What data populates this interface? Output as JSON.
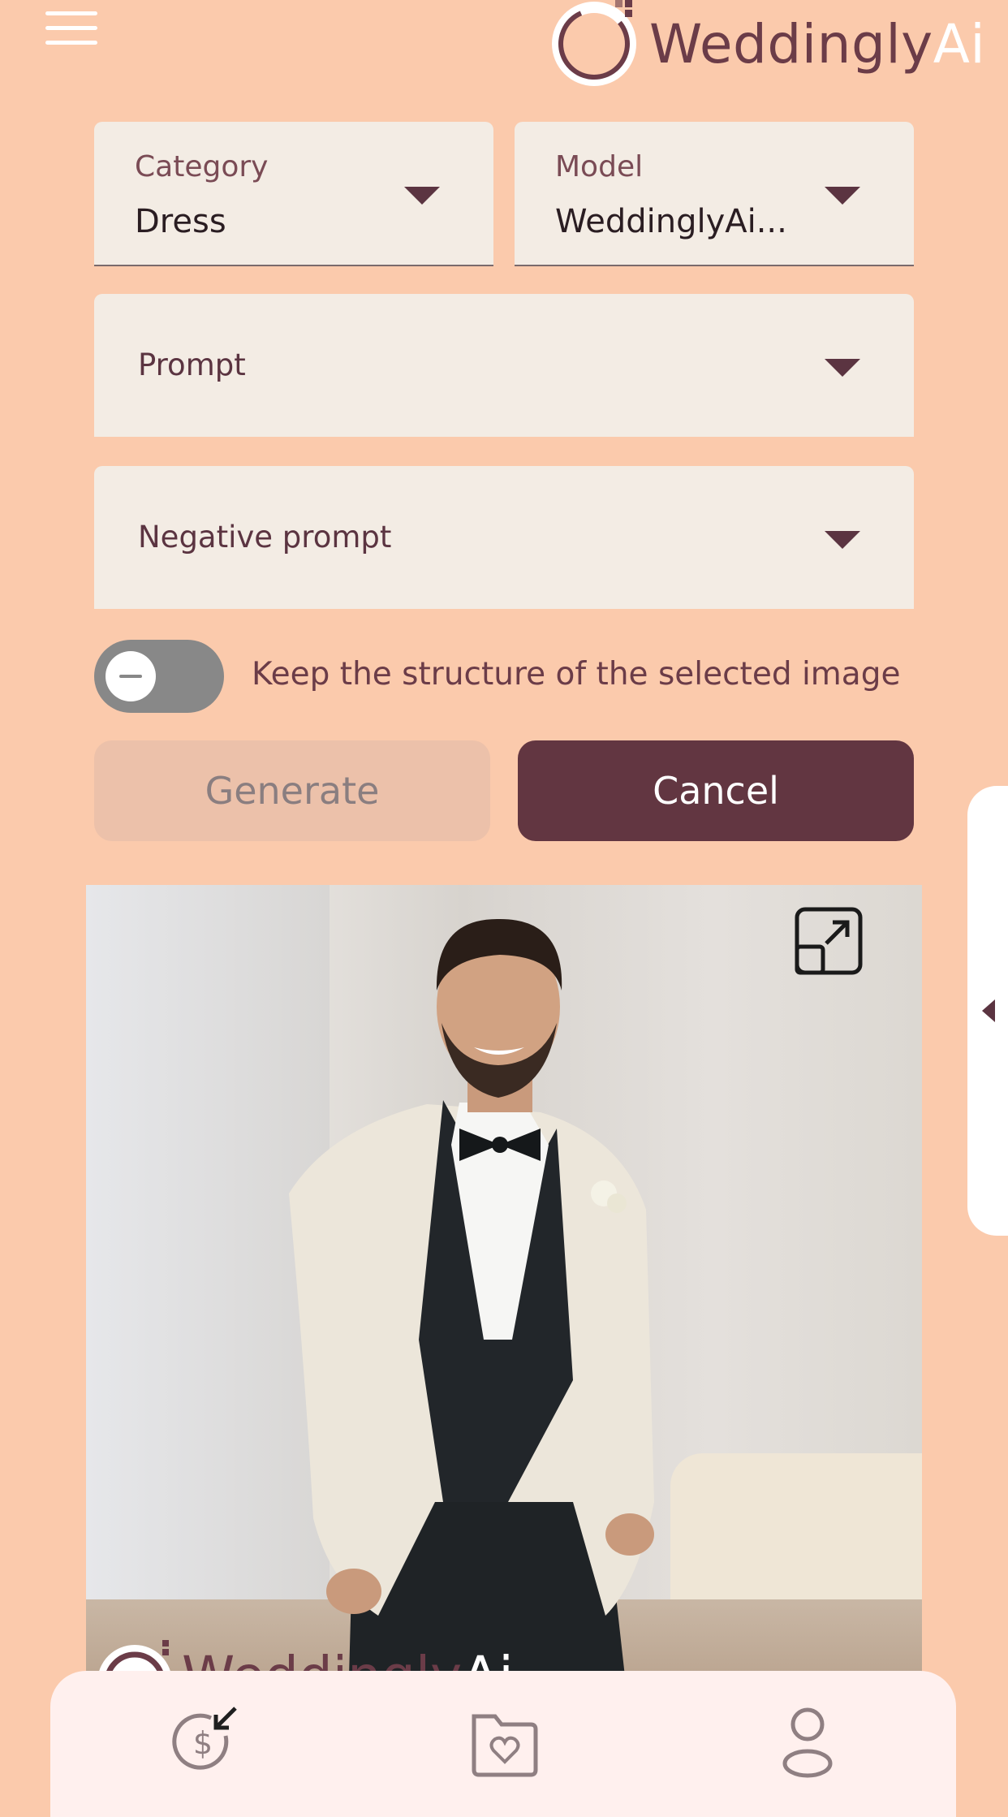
{
  "header": {
    "menu_icon": "hamburger-menu-icon",
    "logo": {
      "text_main": "Weddingly",
      "text_accent": "Ai"
    }
  },
  "form": {
    "category": {
      "label": "Category",
      "value": "Dress"
    },
    "model": {
      "label": "Model",
      "value": "WeddinglyAi..."
    },
    "prompt": {
      "placeholder": "Prompt"
    },
    "negative_prompt": {
      "placeholder": "Negative prompt"
    },
    "keep_structure": {
      "label": "Keep the structure of the selected image",
      "enabled": false
    }
  },
  "actions": {
    "generate_label": "Generate",
    "cancel_label": "Cancel"
  },
  "preview": {
    "watermark_main": "Weddingly",
    "watermark_accent": "Ai",
    "expand_icon": "expand-icon"
  },
  "bottom_nav": {
    "items": [
      {
        "icon": "credits-dollar-icon"
      },
      {
        "icon": "favorites-folder-icon"
      },
      {
        "icon": "profile-user-icon"
      }
    ]
  },
  "colors": {
    "background": "#fbcaac",
    "field_bg": "#f3ece4",
    "accent": "#623641",
    "disabled_button": "#ecc1aa",
    "nav_bg": "#fff0ee"
  }
}
